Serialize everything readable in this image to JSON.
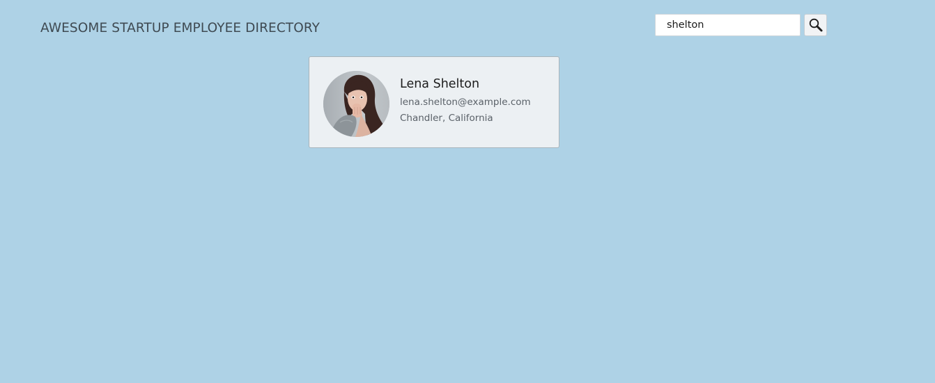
{
  "header": {
    "title": "AWESOME STARTUP EMPLOYEE DIRECTORY"
  },
  "search": {
    "value": "shelton",
    "button_icon": "search-icon"
  },
  "colors": {
    "background": "#aed2e6",
    "card_background": "#ecf0f3",
    "card_border": "#a9b4bb"
  },
  "employees": [
    {
      "name": "Lena Shelton",
      "email": "lena.shelton@example.com",
      "location": "Chandler, California",
      "avatar_icon": "employee-photo"
    }
  ]
}
